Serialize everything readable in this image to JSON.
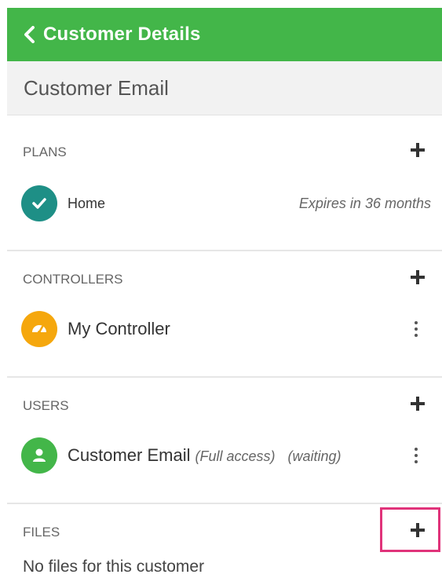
{
  "header": {
    "title": "Customer Details",
    "back_icon": "chevron-left-icon",
    "color": "#43b649"
  },
  "subheader": {
    "title": "Customer Email"
  },
  "plans": {
    "label": "PLANS",
    "items": [
      {
        "name": "Home",
        "status": "Expires in 36 months",
        "icon": "check-circle-icon",
        "color": "#1e8f86"
      }
    ]
  },
  "controllers": {
    "label": "CONTROLLERS",
    "items": [
      {
        "name": "My Controller",
        "icon": "gauge-icon",
        "color": "#f5a70d"
      }
    ]
  },
  "users": {
    "label": "USERS",
    "items": [
      {
        "name": "Customer Email",
        "access": "(Full access)",
        "status": "(waiting)",
        "icon": "user-icon",
        "color": "#43b649"
      }
    ]
  },
  "files": {
    "label": "FILES",
    "empty_text": "No files for this customer",
    "highlight_color": "#e0337a"
  }
}
